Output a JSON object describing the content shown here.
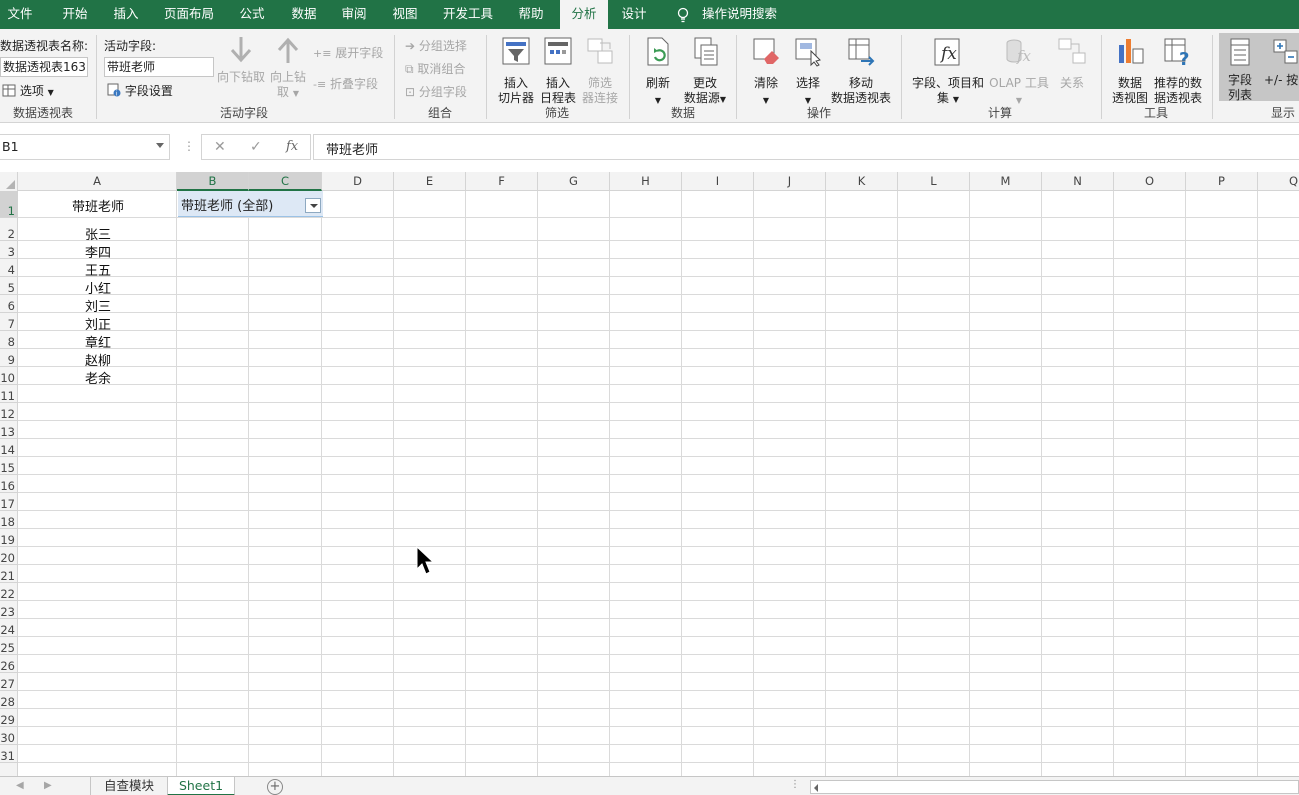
{
  "menu": {
    "tabs": [
      "文件",
      "开始",
      "插入",
      "页面布局",
      "公式",
      "数据",
      "审阅",
      "视图",
      "开发工具",
      "帮助",
      "分析",
      "设计"
    ],
    "active": "分析",
    "tell_me": "操作说明搜索"
  },
  "ribbon": {
    "pivot_table": {
      "name_label": "数据透视表名称:",
      "name_value": "数据透视表163",
      "options_label": "选项",
      "group_label": "数据透视表"
    },
    "active_field": {
      "label": "活动字段:",
      "value": "带班老师",
      "field_settings": "字段设置",
      "drill_down_1": "向下钻取",
      "drill_up_1": "向上钻",
      "drill_up_2": "取",
      "expand_field": "展开字段",
      "collapse_field": "折叠字段",
      "group_label": "活动字段"
    },
    "group": {
      "group_selection": "分组选择",
      "ungroup": "取消组合",
      "group_field": "分组字段",
      "group_label": "组合"
    },
    "filter": {
      "insert_slicer_1": "插入",
      "insert_slicer_2": "切片器",
      "insert_timeline_1": "插入",
      "insert_timeline_2": "日程表",
      "filter_connections_1": "筛选",
      "filter_connections_2": "器连接",
      "group_label": "筛选"
    },
    "data": {
      "refresh": "刷新",
      "change_source_1": "更改",
      "change_source_2": "数据源",
      "group_label": "数据"
    },
    "actions": {
      "clear": "清除",
      "select": "选择",
      "move_1": "移动",
      "move_2": "数据透视表",
      "group_label": "操作"
    },
    "calculations": {
      "fields_items_1": "字段、项目和",
      "fields_items_2": "集",
      "olap_tools": "OLAP 工具",
      "relationships": "关系",
      "group_label": "计算"
    },
    "tools": {
      "pivot_chart_1": "数据",
      "pivot_chart_2": "透视图",
      "recommended_1": "推荐的数",
      "recommended_2": "据透视表",
      "group_label": "工具"
    },
    "show": {
      "field_list_1": "字段",
      "field_list_2": "列表",
      "plus_minus": "+/- 按",
      "group_label": "显示"
    }
  },
  "formula_bar": {
    "name_box": "B1",
    "fx": "fx",
    "content": "带班老师"
  },
  "grid": {
    "columns": [
      "A",
      "B",
      "C",
      "D",
      "E",
      "F",
      "G",
      "H",
      "I",
      "J",
      "K",
      "L",
      "M",
      "N",
      "O",
      "P",
      "Q"
    ],
    "rows": [
      "1",
      "2",
      "3",
      "4",
      "5",
      "6",
      "7",
      "8",
      "9",
      "10",
      "11",
      "12",
      "13",
      "14",
      "15",
      "16",
      "17",
      "18",
      "19",
      "20",
      "21",
      "22",
      "23",
      "24",
      "25",
      "26",
      "27",
      "28",
      "29",
      "30",
      "31"
    ],
    "a1": "带班老师",
    "b1": "带班老师  (全部)",
    "column_a": [
      "张三",
      "李四",
      "王五",
      "小红",
      "刘三",
      "刘正",
      "章红",
      "赵柳",
      "老余"
    ]
  },
  "sheet_tabs": {
    "tabs": [
      "自查模块",
      "Sheet1"
    ],
    "active": "Sheet1"
  },
  "colors": {
    "brand": "#217346",
    "selection": "#dde8f5"
  }
}
